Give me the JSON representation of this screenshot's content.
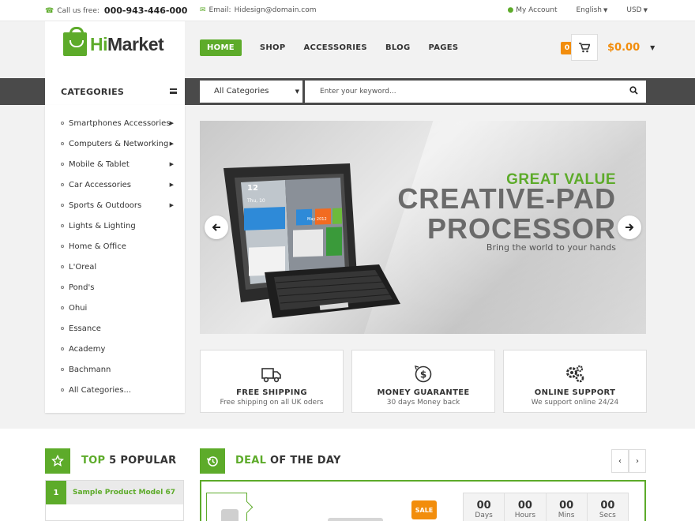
{
  "topbar": {
    "call_label": "Call us free:",
    "phone": "000-943-446-000",
    "email_label": "Email:",
    "email": "Hidesign@domain.com",
    "account": "My Account",
    "language": "English",
    "currency": "USD"
  },
  "logo": {
    "hi": "Hi",
    "market": "Market"
  },
  "nav": [
    "HOME",
    "SHOP",
    "ACCESSORIES",
    "BLOG",
    "PAGES"
  ],
  "cart": {
    "count": "0",
    "total": "$0.00"
  },
  "categories_title": "CATEGORIES",
  "search": {
    "category": "All Categories",
    "placeholder": "Enter your keyword..."
  },
  "sidebar": {
    "items": [
      {
        "label": "Smartphones Accessories",
        "sub": true
      },
      {
        "label": "Computers & Networking",
        "sub": true
      },
      {
        "label": "Mobile & Tablet",
        "sub": true
      },
      {
        "label": "Car Accessories",
        "sub": true
      },
      {
        "label": "Sports & Outdoors",
        "sub": true
      },
      {
        "label": "Lights & Lighting",
        "sub": false
      },
      {
        "label": "Home & Office",
        "sub": false
      },
      {
        "label": "L'Oreal",
        "sub": false
      },
      {
        "label": "Pond's",
        "sub": false
      },
      {
        "label": "Ohui",
        "sub": false
      },
      {
        "label": "Essance",
        "sub": false
      },
      {
        "label": "Academy",
        "sub": false
      },
      {
        "label": "Bachmann",
        "sub": false
      },
      {
        "label": "All Categories...",
        "sub": false
      }
    ]
  },
  "slider": {
    "line1": "GREAT VALUE",
    "line2": "CREATIVE-PAD",
    "line3": "PROCESSOR",
    "line4": "Bring the world to your hands",
    "tablet_time": "12",
    "tablet_day": "Thu, 10",
    "tablet_month": "May 2012"
  },
  "features": [
    {
      "icon": "truck-icon",
      "title": "FREE SHIPPING",
      "desc": "Free shipping on all UK oders"
    },
    {
      "icon": "money-icon",
      "title": "MONEY GUARANTEE",
      "desc": "30 days Money back"
    },
    {
      "icon": "gears-icon",
      "title": "ONLINE SUPPORT",
      "desc": "We support online 24/24"
    }
  ],
  "top_popular": {
    "title_green": "TOP",
    "title_rest": " 5 POPULAR",
    "rank": "1",
    "product": "Sample Product Model 67"
  },
  "deal": {
    "title_green": "DEAL",
    "title_rest": " OF THE DAY",
    "sale": "SALE",
    "countdown": [
      {
        "value": "00",
        "label": "Days"
      },
      {
        "value": "00",
        "label": "Hours"
      },
      {
        "value": "00",
        "label": "Mins"
      },
      {
        "value": "00",
        "label": "Secs"
      }
    ]
  },
  "colors": {
    "accent": "#5dab2a",
    "orange": "#f28d0c",
    "band": "#4a4a4a"
  }
}
